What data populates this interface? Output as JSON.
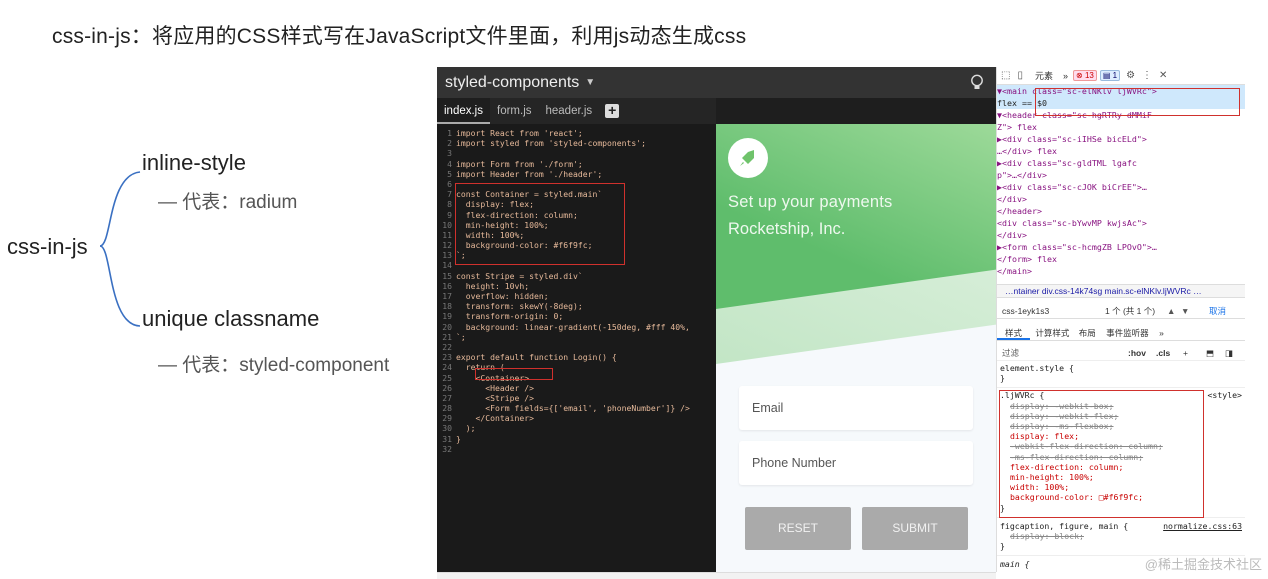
{
  "headline": "css-in-js：将应用的CSS样式写在JavaScript文件里面，利用js动态生成css",
  "mindmap": {
    "root": "css-in-js",
    "branch1": "inline-style",
    "branch1_sub": "— 代表：radium",
    "branch2": "unique classname",
    "branch2_sub": "— 代表：styled-component"
  },
  "editor": {
    "title": "styled-components",
    "tabs": [
      "index.js",
      "form.js",
      "header.js"
    ],
    "code": [
      "import React from 'react';",
      "import styled from 'styled-components';",
      "",
      "import Form from './form';",
      "import Header from './header';",
      "",
      "const Container = styled.main`",
      "  display: flex;",
      "  flex-direction: column;",
      "  min-height: 100%;",
      "  width: 100%;",
      "  background-color: #f6f9fc;",
      "`;",
      "",
      "const Stripe = styled.div`",
      "  height: 10vh;",
      "  overflow: hidden;",
      "  transform: skewY(-8deg);",
      "  transform-origin: 0;",
      "  background: linear-gradient(-150deg, #fff 40%,",
      "`;",
      "",
      "export default function Login() {",
      "  return (",
      "    <Container>",
      "      <Header />",
      "      <Stripe />",
      "      <Form fields={['email', 'phoneNumber']} />",
      "    </Container>",
      "  );",
      "}",
      ""
    ]
  },
  "preview": {
    "line1": "Set up your payments",
    "line2": "Rocketship, Inc.",
    "email_placeholder": "Email",
    "phone_placeholder": "Phone Number",
    "reset_label": "RESET",
    "submit_label": "SUBMIT"
  },
  "devtools": {
    "panel_tab": "元素",
    "more": "»",
    "errors": "13",
    "messages": "1",
    "dom": [
      "▼<main class=\"sc-elNKlv ljWVRc\">",
      "  flex  == $0",
      "  ▼<header class=\"sc-hgRTRy dMMiF",
      "   Z\"> flex",
      "    ▶<div class=\"sc-iIHSe bicELd\">",
      "     …</div> flex",
      "    ▶<div class=\"sc-gldTML lgafc",
      "     p\">…</div>",
      "    ▶<div class=\"sc-cJOK biCrEE\">…",
      "     </div>",
      "   </header>",
      "   <div class=\"sc-bYwvMP kwjsAc\">",
      "   </div>",
      "  ▶<form class=\"sc-hcmgZB LPOvO\">…",
      "   </form> flex",
      "  </main>"
    ],
    "breadcrumb": "…ntainer   div.css-14k74sg   main.sc-elNKlv.ljWVRc   …",
    "search_value": "css-1eyk1s3",
    "search_count": "1 个 (共 1 个)",
    "cancel": "取消",
    "style_tabs": [
      "样式",
      "计算样式",
      "布局",
      "事件监听器",
      "»"
    ],
    "filter_placeholder": "过滤",
    "hov": ":hov",
    "cls": ".cls",
    "styles": {
      "element_style": "element.style {",
      "close": "}",
      "rule_selector": ".ljWVRc {",
      "rule_source": "<style>",
      "rule_props": [
        {
          "text": "display: -webkit-box;",
          "struck": true
        },
        {
          "text": "display: -webkit-flex;",
          "struck": true
        },
        {
          "text": "display: -ms-flexbox;",
          "struck": true
        },
        {
          "text": "display: flex;",
          "struck": false
        },
        {
          "text": "-webkit-flex-direction: column;",
          "struck": true
        },
        {
          "text": "-ms-flex-direction: column;",
          "struck": true
        },
        {
          "text": "flex-direction: column;",
          "struck": false
        },
        {
          "text": "min-height: 100%;",
          "struck": false
        },
        {
          "text": "width: 100%;",
          "struck": false
        },
        {
          "text": "background-color: □#f6f9fc;",
          "struck": false
        }
      ],
      "figcaption_selector": "figcaption, figure, main {",
      "figcaption_source": "normalize.css:63",
      "figcaption_prop": "display: block;",
      "main_selector": "main {"
    }
  },
  "watermark": "@稀土掘金技术社区"
}
